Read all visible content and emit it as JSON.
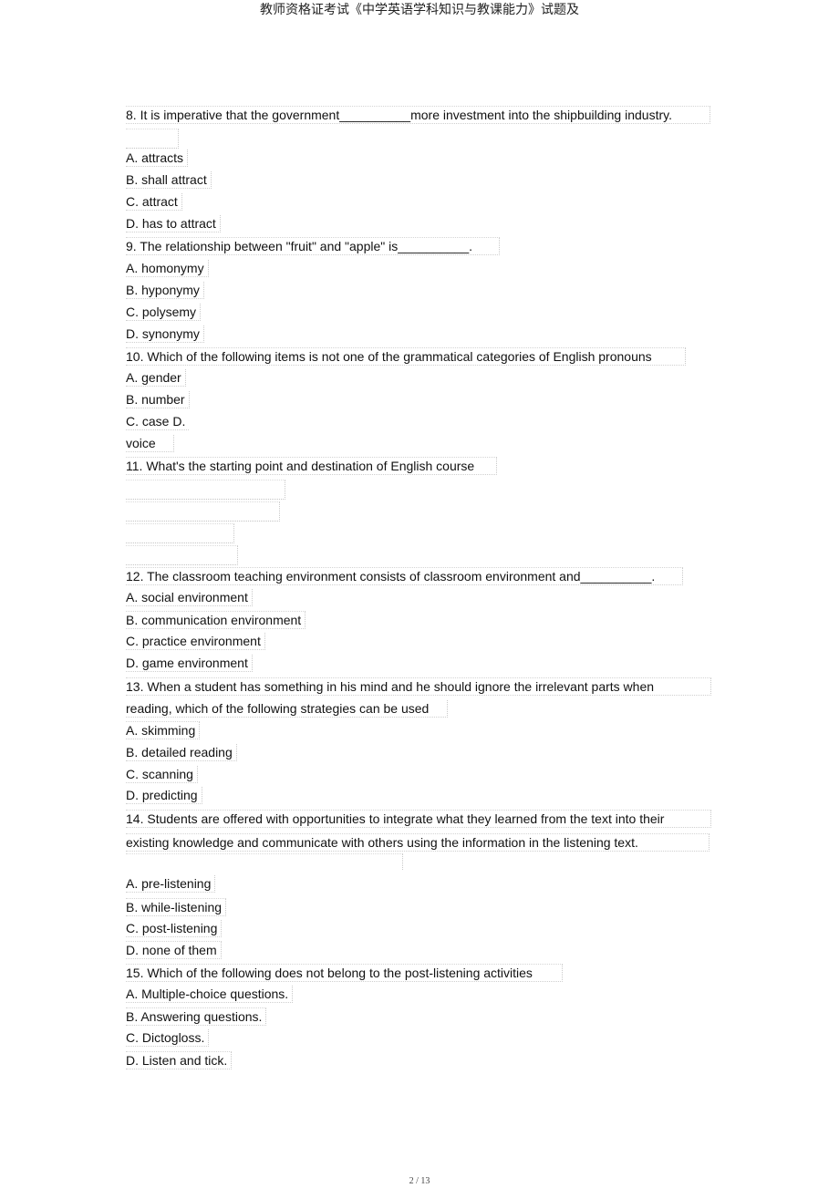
{
  "header": {
    "title": "教师资格证考试《中学英语学科知识与教课能力》试题及"
  },
  "questions": [
    {
      "number": "8.",
      "text": "8.  It is imperative that the government__________more investment into the shipbuilding industry.",
      "options": [
        "A. attracts",
        "B. shall attract",
        "C. attract",
        "D. has to attract"
      ]
    },
    {
      "number": "9.",
      "text": "9. The relationship between \"fruit\" and \"apple\" is__________.",
      "options": [
        "A. homonymy",
        "B. hyponymy",
        "C. polysemy",
        "D. synonymy"
      ]
    },
    {
      "number": "10.",
      "text": "10. Which of the following items is not one of the grammatical categories of English pronouns",
      "options": [
        "A. gender",
        "B. number",
        "C. case D.",
        "voice"
      ]
    },
    {
      "number": "11.",
      "text": "11. What's the starting point and destination of English course",
      "options": []
    },
    {
      "number": "12.",
      "text": "12. The classroom teaching environment consists of classroom environment and__________.",
      "options": [
        "A. social environment",
        "B. communication environment",
        "C. practice environment",
        "D. game environment"
      ]
    },
    {
      "number": "13.",
      "text_lines": [
        "13. When a student has something in his mind and he should ignore the irrelevant parts when",
        "reading, which of the following strategies can be used"
      ],
      "options": [
        "A. skimming",
        "B. detailed reading",
        "C. scanning",
        "D. predicting"
      ]
    },
    {
      "number": "14.",
      "text_lines": [
        "14.  Students are offered with opportunities to integrate what they learned from the text into their",
        "existing knowledge and communicate with others using the information in the listening text."
      ],
      "options": [
        "A. pre-listening",
        "B. while-listening",
        "C. post-listening",
        "D. none of them"
      ]
    },
    {
      "number": "15.",
      "text": "15. Which of the following does not belong to the post-listening activities",
      "options": [
        "A. Multiple-choice questions.",
        "B. Answering questions.",
        "C. Dictogloss.",
        "D. Listen and tick."
      ]
    }
  ],
  "footer": {
    "page_indicator": "2 / 13"
  }
}
